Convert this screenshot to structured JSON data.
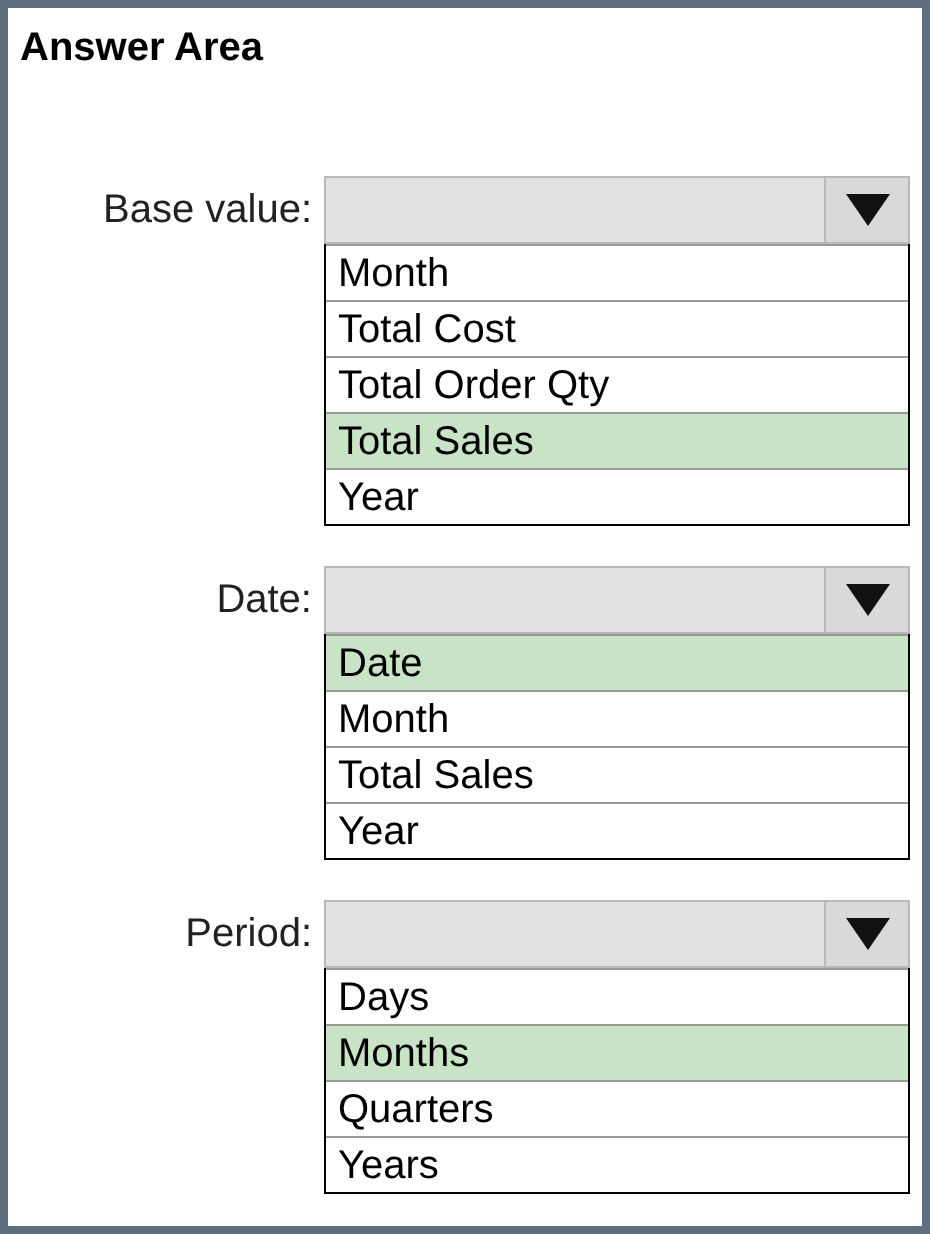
{
  "title": "Answer Area",
  "groups": [
    {
      "label": "Base value:",
      "options": [
        {
          "text": "Month",
          "selected": false
        },
        {
          "text": "Total Cost",
          "selected": false
        },
        {
          "text": "Total Order Qty",
          "selected": false
        },
        {
          "text": "Total Sales",
          "selected": true
        },
        {
          "text": "Year",
          "selected": false
        }
      ]
    },
    {
      "label": "Date:",
      "options": [
        {
          "text": "Date",
          "selected": true
        },
        {
          "text": "Month",
          "selected": false
        },
        {
          "text": "Total Sales",
          "selected": false
        },
        {
          "text": "Year",
          "selected": false
        }
      ]
    },
    {
      "label": "Period:",
      "options": [
        {
          "text": "Days",
          "selected": false
        },
        {
          "text": "Months",
          "selected": true
        },
        {
          "text": "Quarters",
          "selected": false
        },
        {
          "text": "Years",
          "selected": false
        }
      ]
    }
  ]
}
